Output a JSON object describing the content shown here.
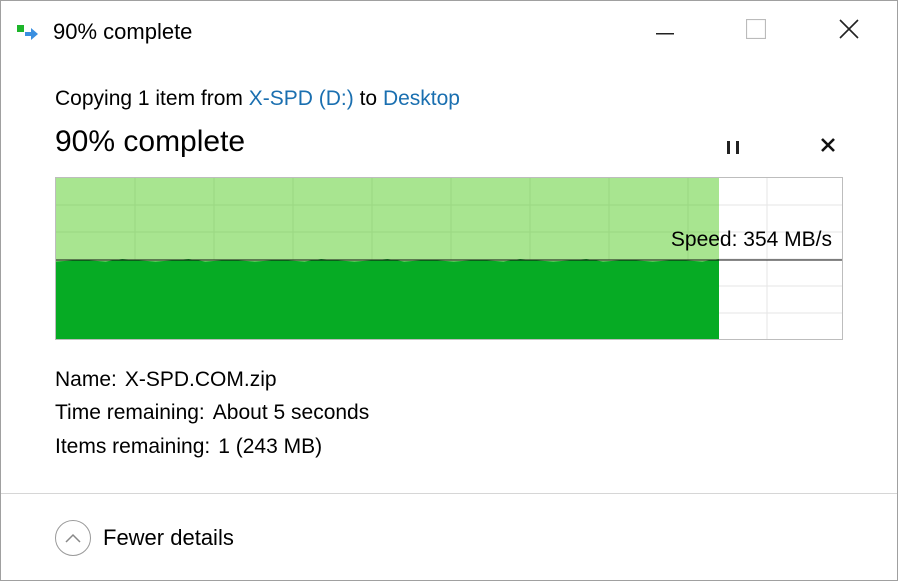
{
  "window": {
    "title": "90% complete",
    "icon": "copy-arrow-icon",
    "controls": {
      "minimize": "minimize-icon",
      "maximize": "maximize-icon",
      "close": "close-icon"
    }
  },
  "copy": {
    "prefix": "Copying 1 item from ",
    "source": "X-SPD (D:)",
    "middle": " to ",
    "destination": "Desktop"
  },
  "status": {
    "text": "90% complete",
    "progress_percent": 90
  },
  "actions": {
    "pause": "pause-icon",
    "cancel": "cancel-icon"
  },
  "chart": {
    "speed_label": "Speed: 354 MB/s",
    "speed_fraction": 0.5
  },
  "details": {
    "name_label": "Name:",
    "name_value": "X-SPD.COM.zip",
    "time_label": "Time remaining:",
    "time_value": "About 5 seconds",
    "items_label": "Items remaining:",
    "items_value": "1 (243 MB)"
  },
  "footer": {
    "fewer_details": "Fewer details",
    "icon": "chevron-up-icon"
  },
  "colors": {
    "link": "#1a6fb0",
    "progress_light": "#a8e590",
    "progress_dark": "#06ab24"
  }
}
